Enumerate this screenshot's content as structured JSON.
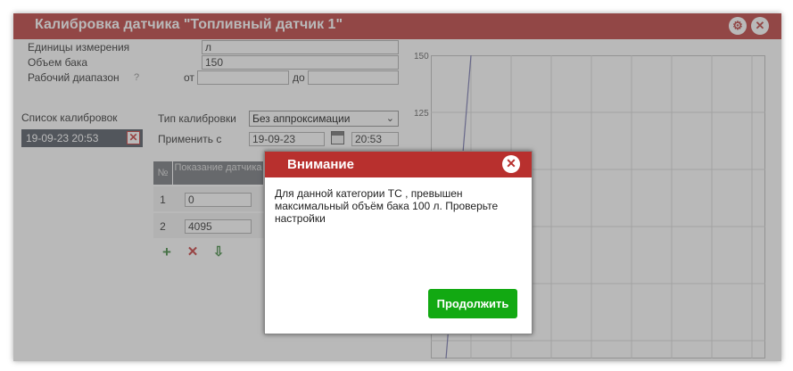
{
  "window": {
    "title": "Калибровка датчика \"Топливный датчик 1\""
  },
  "form": {
    "units_label": "Единицы измерения",
    "units_value": "л",
    "tank_volume_label": "Объем бака",
    "tank_volume_value": "150",
    "range_label": "Рабочий диапазон",
    "range_help": "?",
    "range_from_label": "от",
    "range_from_value": "",
    "range_to_label": "до",
    "range_to_value": ""
  },
  "calibrations": {
    "list_label": "Список калибровок",
    "items": [
      {
        "label": "19-09-23 20:53"
      }
    ],
    "delete_symbol": "✕"
  },
  "calibration_settings": {
    "type_label": "Тип калибровки",
    "type_value": "Без аппроксимации",
    "apply_label": "Применить с",
    "apply_date": "19-09-23",
    "apply_time": "20:53"
  },
  "table": {
    "headers": [
      "№",
      "Показание датчика",
      "",
      ""
    ],
    "rows": [
      {
        "num": "1",
        "value": "0"
      },
      {
        "num": "2",
        "value": "4095"
      }
    ]
  },
  "toolbar": {
    "add_symbol": "+",
    "delete_symbol": "✕",
    "import_symbol": "⇩"
  },
  "chart_data": {
    "type": "line",
    "y_ticks": [
      "150",
      "125"
    ],
    "ylim": [
      0,
      150
    ],
    "grid": true,
    "grid_color": "#d6d6d6",
    "line_color": "#6a6aa8"
  },
  "dialog": {
    "title": "Внимание",
    "message": "Для данной категории ТС , превышен максимальный объём бака 100 л. Проверьте настройки",
    "continue_label": "Продолжить",
    "close_symbol": "✕"
  },
  "colors": {
    "header": "#b8302e",
    "accent_button": "#12a912",
    "selected_item": "#444b57"
  }
}
